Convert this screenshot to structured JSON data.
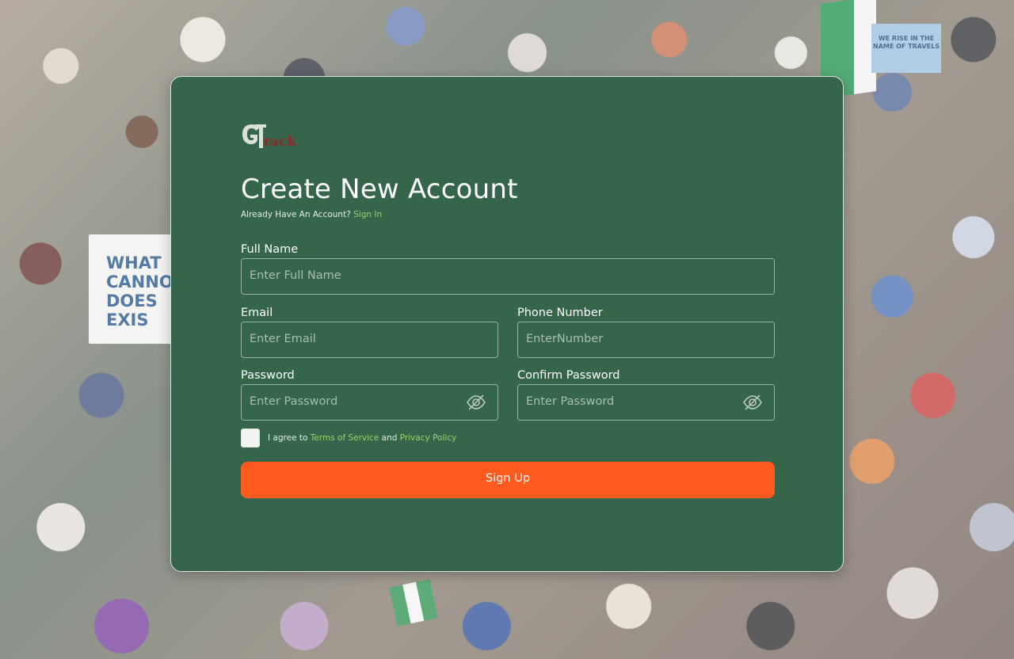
{
  "background": {
    "sign_text": "WHAT CANNO DOES EXIS",
    "small_sign_text": "WE RISE IN THE NAME OF TRAVELS"
  },
  "brand": {
    "logo_text": "GTrack",
    "primary_color": "#35654a",
    "accent_color": "#fe5a1d",
    "link_color": "#9bd36a"
  },
  "form": {
    "title": "Create New Account",
    "subtitle_prefix": "Already Have  An Account?",
    "signin_link": "Sign In",
    "full_name": {
      "label": "Full Name",
      "placeholder": "Enter Full Name",
      "value": ""
    },
    "email": {
      "label": "Email",
      "placeholder": "Enter Email",
      "value": ""
    },
    "phone": {
      "label": "Phone Number",
      "placeholder": "EnterNumber",
      "value": ""
    },
    "password": {
      "label": "Password",
      "placeholder": "Enter Password",
      "value": "",
      "icon": "eye-slash-icon"
    },
    "confirm_password": {
      "label": "Confirm Password",
      "placeholder": "Enter Password",
      "value": "",
      "icon": "eye-slash-icon"
    },
    "agree": {
      "checked": false,
      "prefix": "I agree to",
      "terms_link": "Terms of Service",
      "and": "and",
      "privacy_link": "Privacy Policy"
    },
    "submit_label": "Sign Up"
  }
}
